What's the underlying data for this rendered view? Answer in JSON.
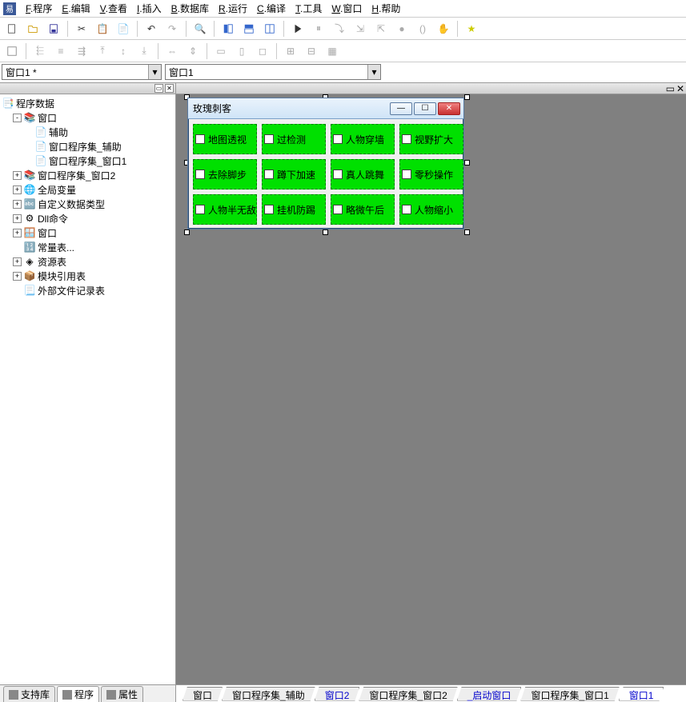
{
  "menu": {
    "items": [
      {
        "u": "F",
        "label": ".程序"
      },
      {
        "u": "E",
        "label": ".编辑"
      },
      {
        "u": "V",
        "label": ".查看"
      },
      {
        "u": "I",
        "label": ".插入"
      },
      {
        "u": "B",
        "label": ".数据库"
      },
      {
        "u": "R",
        "label": ".运行"
      },
      {
        "u": "C",
        "label": ".编译"
      },
      {
        "u": "T",
        "label": ".工具"
      },
      {
        "u": "W",
        "label": ".窗口"
      },
      {
        "u": "H",
        "label": ".帮助"
      }
    ]
  },
  "selectors": {
    "sel1": "窗口1 *",
    "sel2": "窗口1"
  },
  "tree": {
    "root": "程序数据",
    "items": [
      {
        "indent": 1,
        "exp": "-",
        "icon": "stack",
        "label": "窗口"
      },
      {
        "indent": 2,
        "exp": "",
        "icon": "doc",
        "label": "辅助"
      },
      {
        "indent": 2,
        "exp": "",
        "icon": "doc",
        "label": "窗口程序集_辅助"
      },
      {
        "indent": 2,
        "exp": "",
        "icon": "doc",
        "label": "窗口程序集_窗口1"
      },
      {
        "indent": 1,
        "exp": "+",
        "icon": "stack",
        "label": "窗口程序集_窗口2"
      },
      {
        "indent": 1,
        "exp": "+",
        "icon": "globe",
        "label": "全局变量"
      },
      {
        "indent": 1,
        "exp": "+",
        "icon": "type",
        "label": "自定义数据类型"
      },
      {
        "indent": 1,
        "exp": "+",
        "icon": "dll",
        "label": "Dll命令"
      },
      {
        "indent": 1,
        "exp": "+",
        "icon": "win",
        "label": "窗口"
      },
      {
        "indent": 1,
        "exp": "",
        "icon": "const",
        "label": "常量表..."
      },
      {
        "indent": 1,
        "exp": "+",
        "icon": "res",
        "label": "资源表"
      },
      {
        "indent": 1,
        "exp": "+",
        "icon": "mod",
        "label": "模块引用表"
      },
      {
        "indent": 1,
        "exp": "",
        "icon": "ext",
        "label": "外部文件记录表"
      }
    ]
  },
  "leftTabs": [
    {
      "label": "支持库",
      "active": false
    },
    {
      "label": "程序",
      "active": true
    },
    {
      "label": "属性",
      "active": false
    }
  ],
  "form": {
    "title": "玫瑰刺客",
    "checks": [
      "地图透视",
      "过检测",
      "人物穿墙",
      "视野扩大",
      "去除脚步",
      "蹲下加速",
      "真人跳舞",
      "零秒操作",
      "人物半无敌",
      "挂机防踢",
      "略微午后",
      "人物缩小"
    ]
  },
  "bottomTabs": [
    {
      "label": "窗口",
      "cls": ""
    },
    {
      "label": "窗口程序集_辅助",
      "cls": ""
    },
    {
      "label": "窗口2",
      "cls": "link"
    },
    {
      "label": "窗口程序集_窗口2",
      "cls": ""
    },
    {
      "label": "_启动窗口",
      "cls": "link"
    },
    {
      "label": "窗口程序集_窗口1",
      "cls": ""
    },
    {
      "label": "窗口1",
      "cls": "active"
    }
  ]
}
